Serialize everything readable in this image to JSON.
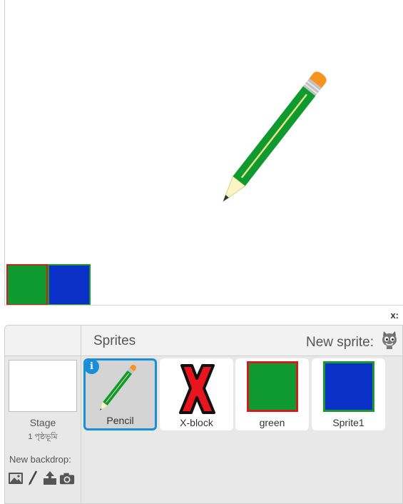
{
  "coord_readout": "x:",
  "sprites_pane": {
    "title": "Sprites",
    "new_sprite_label": "New sprite:",
    "new_sprite_icon": "cat-face-icon"
  },
  "stage_panel": {
    "label": "Stage",
    "sub_label": "1 পৃষ্ঠভূমি",
    "new_backdrop_label": "New backdrop:",
    "backdrop_tools": [
      "image-library-icon",
      "paint-brush-icon",
      "upload-icon",
      "camera-icon"
    ]
  },
  "sprites": [
    {
      "name": "Pencil",
      "selected": true
    },
    {
      "name": "X-block",
      "selected": false
    },
    {
      "name": "green",
      "selected": false
    },
    {
      "name": "Sprite1",
      "selected": false
    }
  ],
  "colors": {
    "selection": "#1b8ed8",
    "pencil_green": "#0f9a30",
    "block_blue": "#0a30c8",
    "x_red": "#e8141e"
  }
}
